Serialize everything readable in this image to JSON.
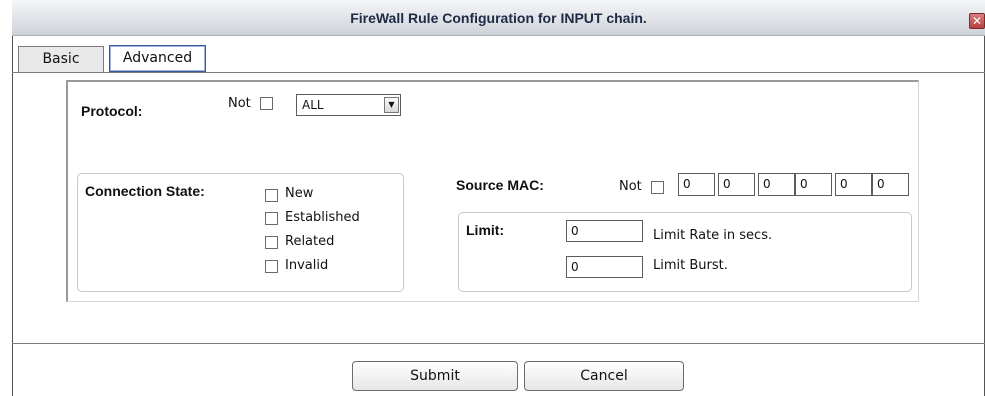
{
  "window": {
    "title": "FireWall Rule Configuration for INPUT chain.",
    "close_glyph": "✕"
  },
  "tabs": [
    {
      "label": "Basic"
    },
    {
      "label": "Advanced"
    }
  ],
  "protocol": {
    "label": "Protocol:",
    "not_label": "Not",
    "selected": "ALL",
    "arrow": "▼"
  },
  "connection_state": {
    "label": "Connection State:",
    "options": [
      {
        "label": "New"
      },
      {
        "label": "Established"
      },
      {
        "label": "Related"
      },
      {
        "label": "Invalid"
      }
    ]
  },
  "source_mac": {
    "label": "Source MAC:",
    "not_label": "Not",
    "octets": [
      "0",
      "0",
      "0",
      "0",
      "0",
      "0"
    ]
  },
  "limit": {
    "label": "Limit:",
    "rate_value": "0",
    "rate_label": "Limit Rate in secs.",
    "burst_value": "0",
    "burst_label": "Limit Burst."
  },
  "buttons": {
    "submit": "Submit",
    "cancel": "Cancel"
  }
}
